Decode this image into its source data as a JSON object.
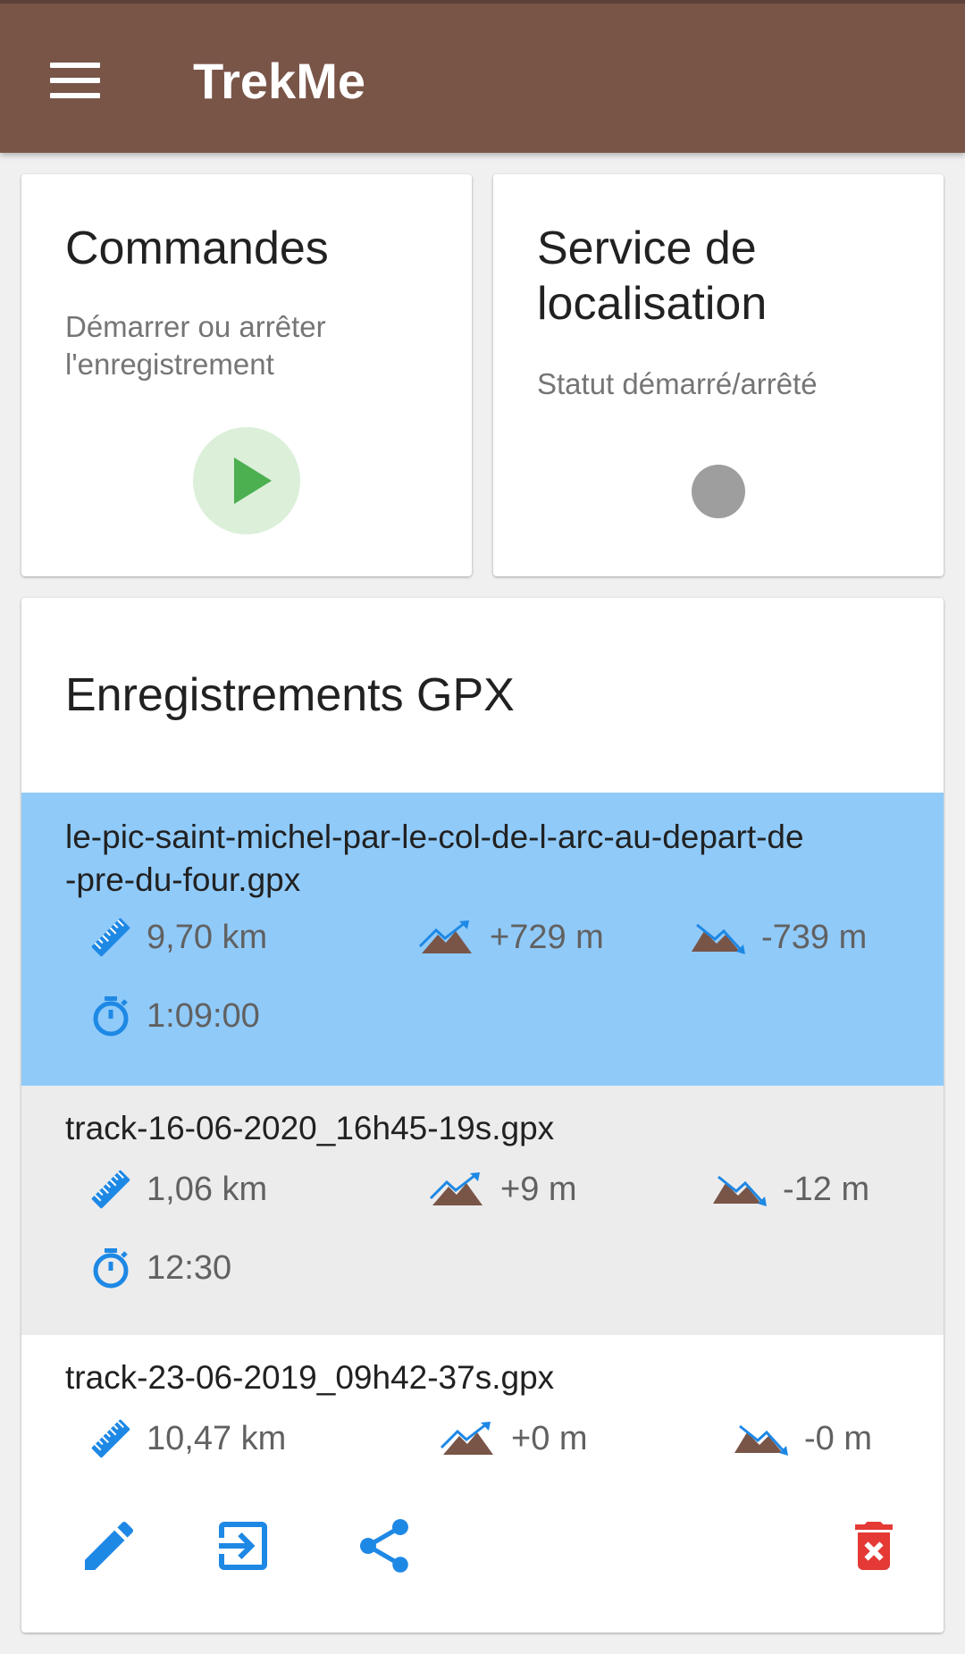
{
  "app": {
    "title": "TrekMe"
  },
  "commands_card": {
    "title": "Commandes",
    "subtitle_line1": "Démarrer ou arrêter",
    "subtitle_line2": "l'enregistrement"
  },
  "location_card": {
    "title_line1": "Service de",
    "title_line2": "localisation",
    "subtitle": "Statut démarré/arrêté",
    "status": "stopped"
  },
  "gpx_card": {
    "title": "Enregistrements GPX",
    "recordings": [
      {
        "name_line1": "le-pic-saint-michel-par-le-col-de-l-arc-au-depart-de",
        "name_line2": "-pre-du-four.gpx",
        "distance": "9,70 km",
        "elevation_up": "+729 m",
        "elevation_down": "-739 m",
        "duration": "1:09:00",
        "state": "selected"
      },
      {
        "name": "track-16-06-2020_16h45-19s.gpx",
        "distance": "1,06 km",
        "elevation_up": "+9 m",
        "elevation_down": "-12 m",
        "duration": "12:30",
        "state": "pressed"
      },
      {
        "name": "track-23-06-2019_09h42-37s.gpx",
        "distance": "10,47 km",
        "elevation_up": "+0 m",
        "elevation_down": "-0 m",
        "state": "normal"
      }
    ],
    "actions": [
      "edit-icon",
      "import-icon",
      "share-icon",
      "delete-icon"
    ]
  },
  "colors": {
    "appbar": "#795548",
    "selected_row": "#90caf9",
    "pressed_row": "#ececec",
    "icon_blue": "#1e88e5",
    "terrain_brown": "#795548",
    "play_green": "#4caf50",
    "delete_red": "#e53935"
  }
}
